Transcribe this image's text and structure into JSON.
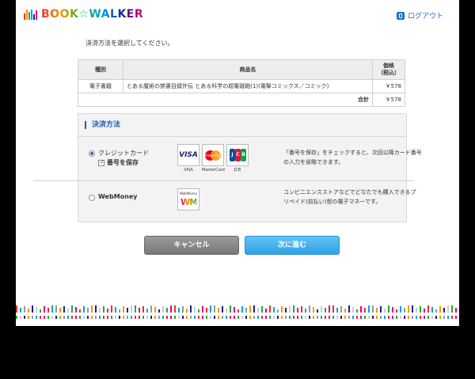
{
  "header": {
    "logo_text": "BOOK☆WALKER",
    "logout_label": "ログアウト",
    "brand_colors": [
      "#e8312f",
      "#f39800",
      "#22ac38",
      "#00a0e9",
      "#1d2088",
      "#e4007f"
    ]
  },
  "instruction": "決済方法を選択してください。",
  "table": {
    "headers": {
      "type": "種別",
      "name": "商品名",
      "price_line1": "価格",
      "price_line2": "（税込）"
    },
    "rows": [
      {
        "type": "電子書籍",
        "name": "とある魔術の禁書目録外伝 とある科学の超電磁砲(1)(電撃コミックス／コミック)",
        "price": "￥578"
      }
    ],
    "total_label": "合計",
    "total_value": "￥578"
  },
  "payment": {
    "title": "決済方法",
    "credit": {
      "label": "クレジットカード",
      "selected": true,
      "save_label": "番号を保存",
      "save_checked": true,
      "cards": [
        {
          "name": "visa-icon",
          "caption": "VISA",
          "text": "VISA"
        },
        {
          "name": "mastercard-icon",
          "caption": "MasterCard",
          "text": "MasterCard"
        },
        {
          "name": "jcb-icon",
          "caption": "JCB",
          "text": "JCB"
        }
      ],
      "description_line1": "「番号を保存」をチェックすると、次回以降カード番号",
      "description_line2": "の入力を省略できます。"
    },
    "webmoney": {
      "label": "WebMoney",
      "selected": false,
      "logo_tag": "WebMoney",
      "logo_text": "WM",
      "description_line1": "コンビニエンスストアなどでどなたでも購入できるプ",
      "description_line2": "リペイド(前払い)型の電子マネーです。"
    }
  },
  "buttons": {
    "cancel": "キャンセル",
    "next": "次に進む"
  }
}
